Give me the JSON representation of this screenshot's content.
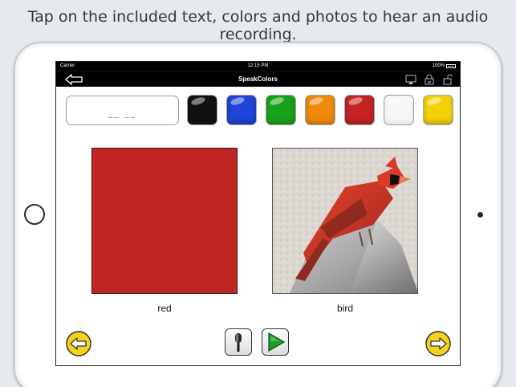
{
  "caption": "Tap on the included text, colors and photos to hear an audio recording.",
  "status_bar": {
    "carrier": "Carrier",
    "time": "12:15 PM",
    "battery": "100%"
  },
  "nav_bar": {
    "title": "SpeakColors",
    "icons": [
      "back-arrow-icon",
      "airplay-icon",
      "share-lock-icon",
      "unlock-icon"
    ]
  },
  "text_box": {
    "value": "__ __"
  },
  "swatches": [
    {
      "name": "black",
      "color": "#111111"
    },
    {
      "name": "blue",
      "color": "#1f44d6"
    },
    {
      "name": "green",
      "color": "#17a21a"
    },
    {
      "name": "orange",
      "color": "#f08a0c"
    },
    {
      "name": "red",
      "color": "#c42323"
    },
    {
      "name": "white",
      "color": "#f6f6f6"
    },
    {
      "name": "yellow",
      "color": "#f4d20a"
    }
  ],
  "panels": {
    "color_label": "red",
    "color_value": "#c12524",
    "photo_label": "bird",
    "photo_subject": "cardinal"
  },
  "toolbar": {
    "icons": [
      "left-arrow-circle-icon",
      "microphone-icon",
      "play-icon",
      "right-arrow-circle-icon"
    ],
    "accent": "#f3d21b"
  }
}
